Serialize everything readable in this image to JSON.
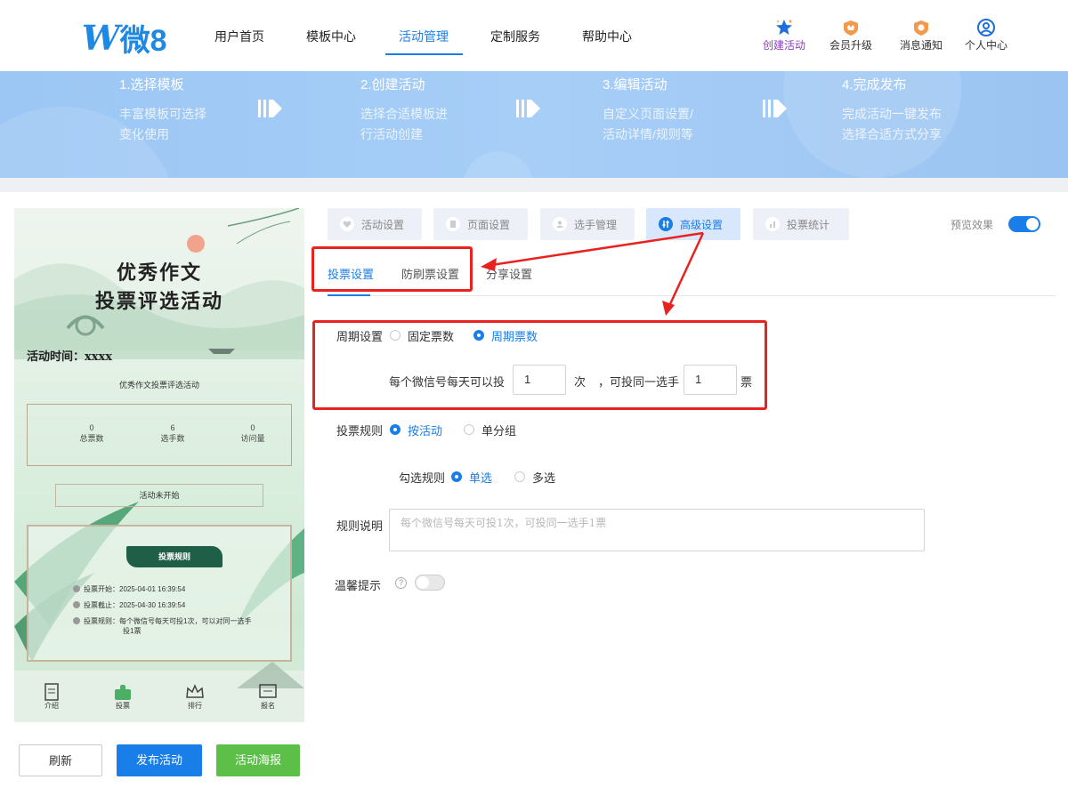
{
  "header": {
    "logo_mark": "W",
    "logo_text": "微8",
    "nav": [
      "用户首页",
      "模板中心",
      "活动管理",
      "定制服务",
      "帮助中心"
    ],
    "actions": [
      {
        "label": "创建活动",
        "icon": "star-sparkle-icon"
      },
      {
        "label": "会员升级",
        "icon": "crown-badge-icon"
      },
      {
        "label": "消息通知",
        "icon": "bell-badge-icon"
      },
      {
        "label": "个人中心",
        "icon": "user-circle-icon"
      }
    ]
  },
  "steps": [
    {
      "title": "1.选择模板",
      "desc1": "丰富模板可选择",
      "desc2": "变化使用"
    },
    {
      "title": "2.创建活动",
      "desc1": "选择合适模板进",
      "desc2": "行活动创建"
    },
    {
      "title": "3.编辑活动",
      "desc1": "自定义页面设置/",
      "desc2": "活动详情/规则等"
    },
    {
      "title": "4.完成发布",
      "desc1": "完成活动一键发布",
      "desc2": "选择合适方式分享"
    }
  ],
  "preview": {
    "title_line1": "优秀作文",
    "title_line2": "投票评选活动",
    "time": "活动时间：xxxx",
    "subtitle": "优秀作文投票评选活动",
    "stats": [
      {
        "value": "0",
        "label": "总票数"
      },
      {
        "value": "6",
        "label": "选手数"
      },
      {
        "value": "0",
        "label": "访问量"
      }
    ],
    "status": "活动未开始",
    "rules_title": "投票规则",
    "rule_lines": [
      "投票开始：2025-04-01 16:39:54",
      "投票截止：2025-04-30 16:39:54",
      "投票规则：每个微信号每天可投1次，可以对同一选手",
      "投1票"
    ],
    "tabs": [
      {
        "label": "介绍",
        "icon": "document-icon"
      },
      {
        "label": "投票",
        "icon": "thumbs-up-icon"
      },
      {
        "label": "排行",
        "icon": "crown-icon"
      },
      {
        "label": "报名",
        "icon": "edit-form-icon"
      }
    ]
  },
  "buttons": {
    "refresh": "刷新",
    "publish": "发布活动",
    "poster": "活动海报"
  },
  "settings_tabs": [
    {
      "label": "活动设置",
      "icon": "heart-icon"
    },
    {
      "label": "页面设置",
      "icon": "page-icon"
    },
    {
      "label": "选手管理",
      "icon": "person-icon"
    },
    {
      "label": "高级设置",
      "icon": "sliders-icon"
    },
    {
      "label": "投票统计",
      "icon": "chart-icon"
    }
  ],
  "preview_toggle": {
    "label": "预览效果",
    "on": true
  },
  "sub_tabs": [
    "投票设置",
    "防刷票设置",
    "分享设置"
  ],
  "form": {
    "period_label": "周期设置",
    "period_options": [
      "固定票数",
      "周期票数"
    ],
    "period_selected": 1,
    "per_day_prefix": "每个微信号每天可以投",
    "per_day_value": "1",
    "per_day_unit": "次",
    "same_player_prefix": "，可投同一选手",
    "same_player_value": "1",
    "same_player_unit": "票",
    "rule_label": "投票规则",
    "rule_options": [
      "按活动",
      "单分组"
    ],
    "rule_selected": 0,
    "check_label": "勾选规则",
    "check_options": [
      "单选",
      "多选"
    ],
    "check_selected": 0,
    "desc_label": "规则说明",
    "desc_placeholder": "每个微信号每天可投1次，可投同一选手1票",
    "tip_label": "温馨提示",
    "tip_help": "?",
    "tip_on": false
  },
  "colors": {
    "accent": "#1a7ee8",
    "annotation": "#e8231f",
    "poster_green": "#5cbf47"
  }
}
